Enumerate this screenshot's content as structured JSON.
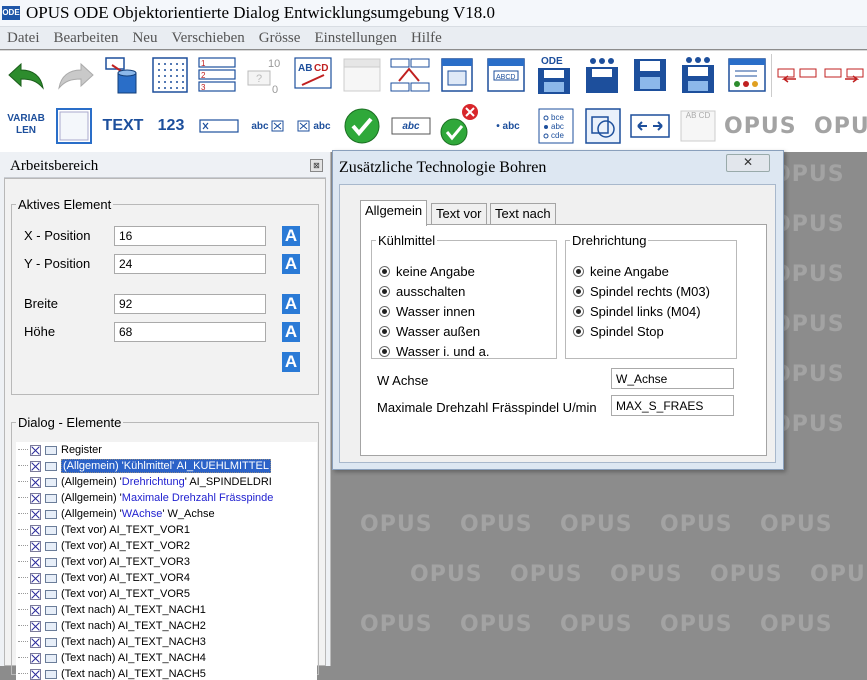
{
  "app": {
    "icon_label": "ODE",
    "title": "OPUS ODE  Objektorientierte Dialog Entwicklungsumgebung V18.0"
  },
  "menu": [
    "Datei",
    "Bearbeiten",
    "Neu",
    "Verschieben",
    "Grösse",
    "Einstellungen",
    "Hilfe"
  ],
  "toolbar1": {
    "icons": [
      "undo-icon",
      "redo-icon",
      "delete-icon",
      "grid-icon",
      "list-icon",
      "numbering-icon",
      "text-field-icon",
      "blank-icon",
      "tab-order-icon",
      "window-icon",
      "dialog-icon",
      "ode-save-icon",
      "save-icon",
      "save-as-icon",
      "form-icon",
      "swap-left-icon",
      "swap-right-icon"
    ],
    "ode_label": "ODE",
    "numbering_top": "10",
    "numbering_bottom": "0"
  },
  "toolbar2": {
    "variab_label": "VARIAB\nLEN",
    "text_label": "TEXT",
    "number_label": "123",
    "abc": "abc",
    "radio_abc": "• abc",
    "bce": "bce",
    "cde": "cde",
    "abcd": "AB CD"
  },
  "workspace": {
    "watermark": "OPUS"
  },
  "panel": {
    "title": "Arbeitsbereich",
    "close_glyph": "⊠",
    "active_element": {
      "legend": "Aktives Element",
      "x_label": "X - Position",
      "x_value": "16",
      "y_label": "Y - Position",
      "y_value": "24",
      "width_label": "Breite",
      "width_value": "92",
      "height_label": "Höhe",
      "height_value": "68",
      "a_button": "A"
    },
    "elements": {
      "legend": "Dialog - Elemente",
      "rows": [
        {
          "prefix": "Register",
          "blue": "",
          "suffix": "",
          "selected": false
        },
        {
          "prefix": "(Allgemein)  '",
          "blue": "Kühlmittel",
          "suffix": "' AI_KUEHLMITTEL",
          "selected": true
        },
        {
          "prefix": "(Allgemein)  '",
          "blue": "Drehrichtung",
          "suffix": "' AI_SPINDELDRI",
          "selected": false
        },
        {
          "prefix": "(Allgemein)  '",
          "blue": "Maximale Drehzahl Frässpinde",
          "suffix": "",
          "selected": false
        },
        {
          "prefix": "(Allgemein)  '",
          "blue": "WAchse",
          "suffix": "'  W_Achse",
          "selected": false
        },
        {
          "prefix": "(Text vor)  AI_TEXT_VOR1",
          "blue": "",
          "suffix": "",
          "selected": false
        },
        {
          "prefix": "(Text vor)  AI_TEXT_VOR2",
          "blue": "",
          "suffix": "",
          "selected": false
        },
        {
          "prefix": "(Text vor)  AI_TEXT_VOR3",
          "blue": "",
          "suffix": "",
          "selected": false
        },
        {
          "prefix": "(Text vor)  AI_TEXT_VOR4",
          "blue": "",
          "suffix": "",
          "selected": false
        },
        {
          "prefix": "(Text vor)  AI_TEXT_VOR5",
          "blue": "",
          "suffix": "",
          "selected": false
        },
        {
          "prefix": "(Text nach)  AI_TEXT_NACH1",
          "blue": "",
          "suffix": "",
          "selected": false
        },
        {
          "prefix": "(Text nach)  AI_TEXT_NACH2",
          "blue": "",
          "suffix": "",
          "selected": false
        },
        {
          "prefix": "(Text nach)  AI_TEXT_NACH3",
          "blue": "",
          "suffix": "",
          "selected": false
        },
        {
          "prefix": "(Text nach)  AI_TEXT_NACH4",
          "blue": "",
          "suffix": "",
          "selected": false
        },
        {
          "prefix": "(Text nach)  AI_TEXT_NACH5",
          "blue": "",
          "suffix": "",
          "selected": false
        }
      ]
    }
  },
  "dialog": {
    "title": "Zusätzliche Technologie Bohren",
    "close_glyph": "✕",
    "tabs": [
      "Allgemein",
      "Text vor",
      "Text nach"
    ],
    "active_tab": "Allgemein",
    "kuehlmittel": {
      "legend": "Kühlmittel",
      "options": [
        "keine Angabe",
        "ausschalten",
        "Wasser innen",
        "Wasser außen",
        "Wasser i. und a."
      ]
    },
    "drehrichtung": {
      "legend": "Drehrichtung",
      "options": [
        "keine Angabe",
        "Spindel rechts (M03)",
        "Spindel links (M04)",
        "Spindel Stop"
      ]
    },
    "w_achse_label": "W Achse",
    "w_achse_value": "W_Achse",
    "drehzahl_label": "Maximale Drehzahl Frässpindel U/min",
    "drehzahl_value": "MAX_S_FRAES"
  },
  "colors": {
    "accent": "#2a7ad6",
    "selection": "#2b62c8",
    "blue_text": "#1e1ecf",
    "workspace": "#8c8c8c"
  }
}
